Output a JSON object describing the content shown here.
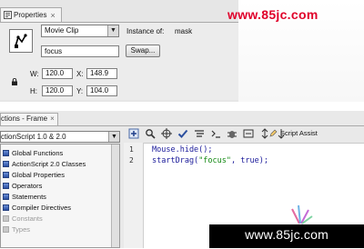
{
  "watermark": {
    "top": "www.85jc.com",
    "bottom": "www.85jc.com"
  },
  "properties": {
    "tab_label": "Properties",
    "tab_close": "×",
    "symbol_type": "Movie Clip",
    "instance_label": "Instance of:",
    "instance_value": "mask",
    "instance_name": "focus",
    "swap_label": "Swap...",
    "w_label": "W:",
    "w_value": "120.0",
    "x_label": "X:",
    "x_value": "148.9",
    "h_label": "H:",
    "h_value": "120.0",
    "y_label": "Y:",
    "y_value": "104.0"
  },
  "actions": {
    "tab_label": "ctions - Frame",
    "tab_close": "×",
    "version": "ctionScript 1.0 & 2.0",
    "script_assist_label": "Script Assist",
    "toolbox_items": [
      {
        "label": "Global Functions",
        "dim": false
      },
      {
        "label": "ActionScript 2.0 Classes",
        "dim": false
      },
      {
        "label": "Global Properties",
        "dim": false
      },
      {
        "label": "Operators",
        "dim": false
      },
      {
        "label": "Statements",
        "dim": false
      },
      {
        "label": "Compiler Directives",
        "dim": false
      },
      {
        "label": "Constants",
        "dim": true
      },
      {
        "label": "Types",
        "dim": true
      }
    ],
    "code_lines": [
      {
        "num": "1",
        "code": "Mouse.hide();"
      },
      {
        "num": "2",
        "code_pre": "startDrag(",
        "code_str": "\"focus\"",
        "code_post": ", true);"
      }
    ],
    "toolbar_icons": [
      "add-icon",
      "find-icon",
      "target-icon",
      "check-icon",
      "format-icon",
      "hint-icon",
      "debug-icon",
      "collapse-icon",
      "collapse-selection-icon",
      "expand-icon"
    ]
  },
  "colors": {
    "watermark_red": "#e0002a",
    "code_blue": "#1a1a9a",
    "string_green": "#118811"
  }
}
